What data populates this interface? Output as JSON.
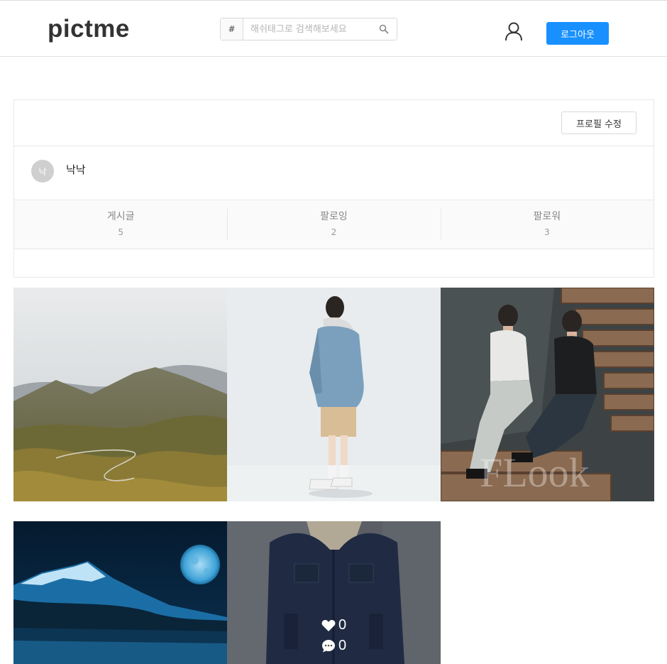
{
  "header": {
    "logo": "pictme",
    "search_hash": "#",
    "search_placeholder": "해쉬태그로 검색해보세요",
    "logout_label": "로그아웃"
  },
  "profile": {
    "edit_label": "프로필 수정",
    "avatar_letter": "낙",
    "username": "낙낙",
    "stats": [
      {
        "label": "게시글",
        "value": "5"
      },
      {
        "label": "팔로잉",
        "value": "2"
      },
      {
        "label": "팔로워",
        "value": "3"
      }
    ]
  },
  "posts": [
    {
      "subject": "mountain-valley"
    },
    {
      "subject": "denim-jacket-model"
    },
    {
      "subject": "two-men-on-pallets",
      "watermark": "FLook"
    },
    {
      "subject": "blue-mountain-moon"
    },
    {
      "subject": "sherpa-denim-jacket",
      "likes": "0",
      "comments": "0"
    }
  ]
}
